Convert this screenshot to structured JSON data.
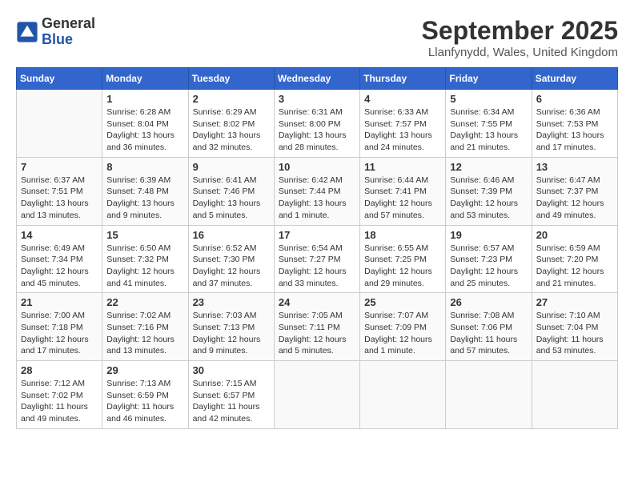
{
  "header": {
    "logo": {
      "general": "General",
      "blue": "Blue"
    },
    "title": "September 2025",
    "location": "Llanfynydd, Wales, United Kingdom"
  },
  "calendar": {
    "weekdays": [
      "Sunday",
      "Monday",
      "Tuesday",
      "Wednesday",
      "Thursday",
      "Friday",
      "Saturday"
    ],
    "weeks": [
      [
        {
          "day": "",
          "info": ""
        },
        {
          "day": "1",
          "info": "Sunrise: 6:28 AM\nSunset: 8:04 PM\nDaylight: 13 hours\nand 36 minutes."
        },
        {
          "day": "2",
          "info": "Sunrise: 6:29 AM\nSunset: 8:02 PM\nDaylight: 13 hours\nand 32 minutes."
        },
        {
          "day": "3",
          "info": "Sunrise: 6:31 AM\nSunset: 8:00 PM\nDaylight: 13 hours\nand 28 minutes."
        },
        {
          "day": "4",
          "info": "Sunrise: 6:33 AM\nSunset: 7:57 PM\nDaylight: 13 hours\nand 24 minutes."
        },
        {
          "day": "5",
          "info": "Sunrise: 6:34 AM\nSunset: 7:55 PM\nDaylight: 13 hours\nand 21 minutes."
        },
        {
          "day": "6",
          "info": "Sunrise: 6:36 AM\nSunset: 7:53 PM\nDaylight: 13 hours\nand 17 minutes."
        }
      ],
      [
        {
          "day": "7",
          "info": "Sunrise: 6:37 AM\nSunset: 7:51 PM\nDaylight: 13 hours\nand 13 minutes."
        },
        {
          "day": "8",
          "info": "Sunrise: 6:39 AM\nSunset: 7:48 PM\nDaylight: 13 hours\nand 9 minutes."
        },
        {
          "day": "9",
          "info": "Sunrise: 6:41 AM\nSunset: 7:46 PM\nDaylight: 13 hours\nand 5 minutes."
        },
        {
          "day": "10",
          "info": "Sunrise: 6:42 AM\nSunset: 7:44 PM\nDaylight: 13 hours\nand 1 minute."
        },
        {
          "day": "11",
          "info": "Sunrise: 6:44 AM\nSunset: 7:41 PM\nDaylight: 12 hours\nand 57 minutes."
        },
        {
          "day": "12",
          "info": "Sunrise: 6:46 AM\nSunset: 7:39 PM\nDaylight: 12 hours\nand 53 minutes."
        },
        {
          "day": "13",
          "info": "Sunrise: 6:47 AM\nSunset: 7:37 PM\nDaylight: 12 hours\nand 49 minutes."
        }
      ],
      [
        {
          "day": "14",
          "info": "Sunrise: 6:49 AM\nSunset: 7:34 PM\nDaylight: 12 hours\nand 45 minutes."
        },
        {
          "day": "15",
          "info": "Sunrise: 6:50 AM\nSunset: 7:32 PM\nDaylight: 12 hours\nand 41 minutes."
        },
        {
          "day": "16",
          "info": "Sunrise: 6:52 AM\nSunset: 7:30 PM\nDaylight: 12 hours\nand 37 minutes."
        },
        {
          "day": "17",
          "info": "Sunrise: 6:54 AM\nSunset: 7:27 PM\nDaylight: 12 hours\nand 33 minutes."
        },
        {
          "day": "18",
          "info": "Sunrise: 6:55 AM\nSunset: 7:25 PM\nDaylight: 12 hours\nand 29 minutes."
        },
        {
          "day": "19",
          "info": "Sunrise: 6:57 AM\nSunset: 7:23 PM\nDaylight: 12 hours\nand 25 minutes."
        },
        {
          "day": "20",
          "info": "Sunrise: 6:59 AM\nSunset: 7:20 PM\nDaylight: 12 hours\nand 21 minutes."
        }
      ],
      [
        {
          "day": "21",
          "info": "Sunrise: 7:00 AM\nSunset: 7:18 PM\nDaylight: 12 hours\nand 17 minutes."
        },
        {
          "day": "22",
          "info": "Sunrise: 7:02 AM\nSunset: 7:16 PM\nDaylight: 12 hours\nand 13 minutes."
        },
        {
          "day": "23",
          "info": "Sunrise: 7:03 AM\nSunset: 7:13 PM\nDaylight: 12 hours\nand 9 minutes."
        },
        {
          "day": "24",
          "info": "Sunrise: 7:05 AM\nSunset: 7:11 PM\nDaylight: 12 hours\nand 5 minutes."
        },
        {
          "day": "25",
          "info": "Sunrise: 7:07 AM\nSunset: 7:09 PM\nDaylight: 12 hours\nand 1 minute."
        },
        {
          "day": "26",
          "info": "Sunrise: 7:08 AM\nSunset: 7:06 PM\nDaylight: 11 hours\nand 57 minutes."
        },
        {
          "day": "27",
          "info": "Sunrise: 7:10 AM\nSunset: 7:04 PM\nDaylight: 11 hours\nand 53 minutes."
        }
      ],
      [
        {
          "day": "28",
          "info": "Sunrise: 7:12 AM\nSunset: 7:02 PM\nDaylight: 11 hours\nand 49 minutes."
        },
        {
          "day": "29",
          "info": "Sunrise: 7:13 AM\nSunset: 6:59 PM\nDaylight: 11 hours\nand 46 minutes."
        },
        {
          "day": "30",
          "info": "Sunrise: 7:15 AM\nSunset: 6:57 PM\nDaylight: 11 hours\nand 42 minutes."
        },
        {
          "day": "",
          "info": ""
        },
        {
          "day": "",
          "info": ""
        },
        {
          "day": "",
          "info": ""
        },
        {
          "day": "",
          "info": ""
        }
      ]
    ]
  }
}
